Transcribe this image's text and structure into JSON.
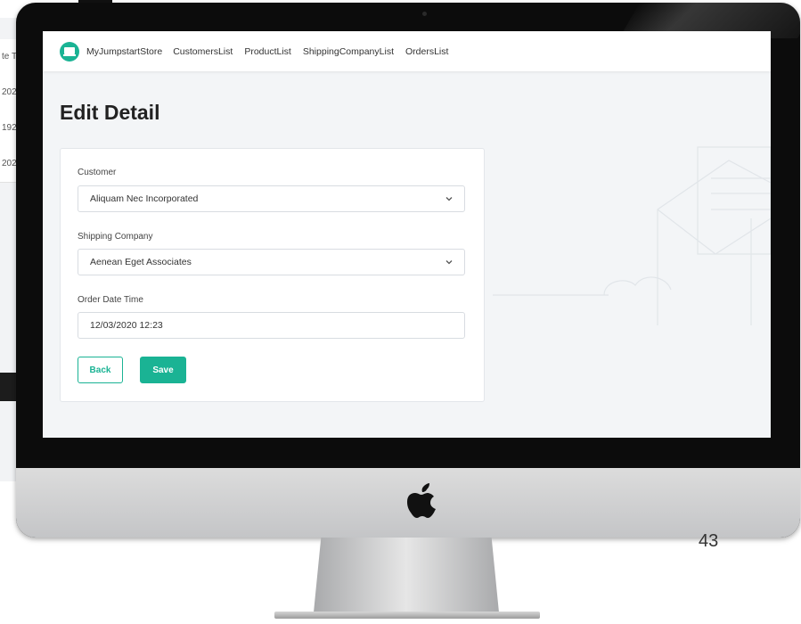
{
  "background": {
    "table_cells": [
      "te T",
      "202",
      "192",
      "202"
    ]
  },
  "slide": {
    "page_number": "43"
  },
  "navbar": {
    "brand": "MyJumpstartStore",
    "links": [
      "CustomersList",
      "ProductList",
      "ShippingCompanyList",
      "OrdersList"
    ]
  },
  "page": {
    "title": "Edit Detail"
  },
  "form": {
    "customer": {
      "label": "Customer",
      "value": "Aliquam Nec Incorporated"
    },
    "shipping_company": {
      "label": "Shipping Company",
      "value": "Aenean Eget Associates"
    },
    "order_date_time": {
      "label": "Order Date Time",
      "value": "12/03/2020 12:23"
    },
    "back_label": "Back",
    "save_label": "Save"
  },
  "colors": {
    "accent": "#1ab394",
    "screen_bg": "#f3f5f7",
    "bezel": "#0c0c0c"
  },
  "icons": {
    "brand": "laptop-icon",
    "dropdown": "chevron-down-icon",
    "monitor_logo": "apple-logo-icon"
  }
}
